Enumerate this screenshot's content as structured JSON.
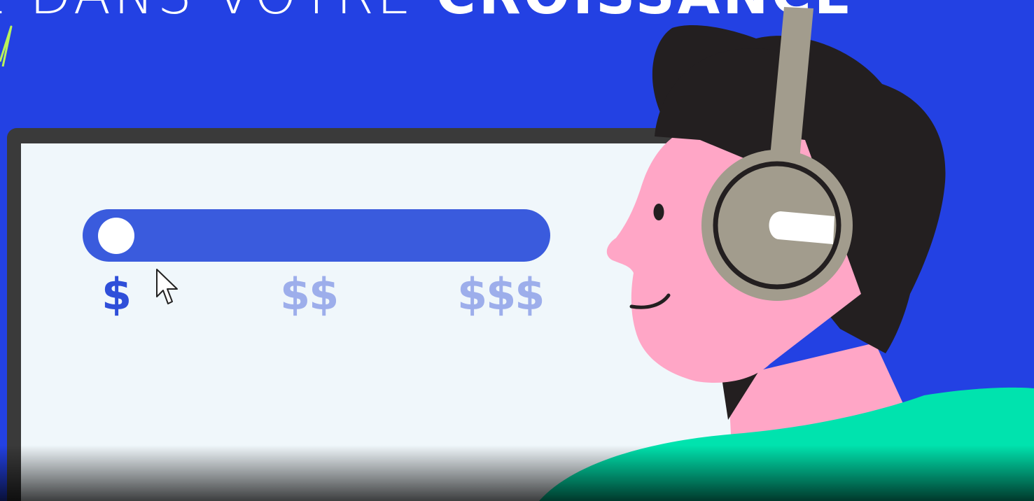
{
  "headline": {
    "light_text": "E DANS VOTRE",
    "bold_text": "CROISSANCE"
  },
  "price_slider": {
    "level": 0,
    "labels": [
      "$",
      "$$",
      "$$$"
    ],
    "track_color": "#3A5BDD",
    "knob_color": "#FFFFFF",
    "active_label_color": "#2F4FD9",
    "inactive_label_color": "#9DAEEB"
  },
  "colors": {
    "background": "#2341E3",
    "screen": "#F0F7FB",
    "monitor_frame": "#3A3A3A",
    "skin": "#FFA6C6",
    "hair": "#231F20",
    "headphones": "#A29C8D",
    "shirt": "#00E3AE"
  },
  "icons": {
    "cursor": "mouse-pointer-icon"
  }
}
